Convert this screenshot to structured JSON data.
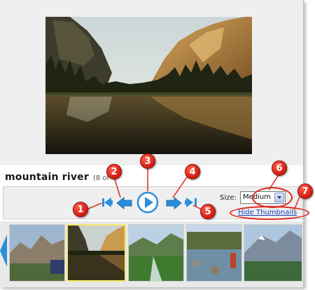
{
  "photo": {
    "title": "mountain river",
    "count_text": "(8 of"
  },
  "controls": {
    "first_icon": "first-photo-icon",
    "prev_icon": "previous-photo-icon",
    "play_icon": "play-slideshow-icon",
    "next_icon": "next-photo-icon",
    "last_icon": "last-photo-icon"
  },
  "size": {
    "label": "Size:",
    "selected": "Medium"
  },
  "thumbnails_toggle": "Hide Thumbnails",
  "callouts": [
    "1",
    "2",
    "3",
    "4",
    "5",
    "6",
    "7"
  ],
  "colors": {
    "callout": "#e0291d",
    "nav_arrow": "#2a8fd8",
    "link": "#1d3fb8",
    "selected_thumb": "#f4ea6a"
  }
}
